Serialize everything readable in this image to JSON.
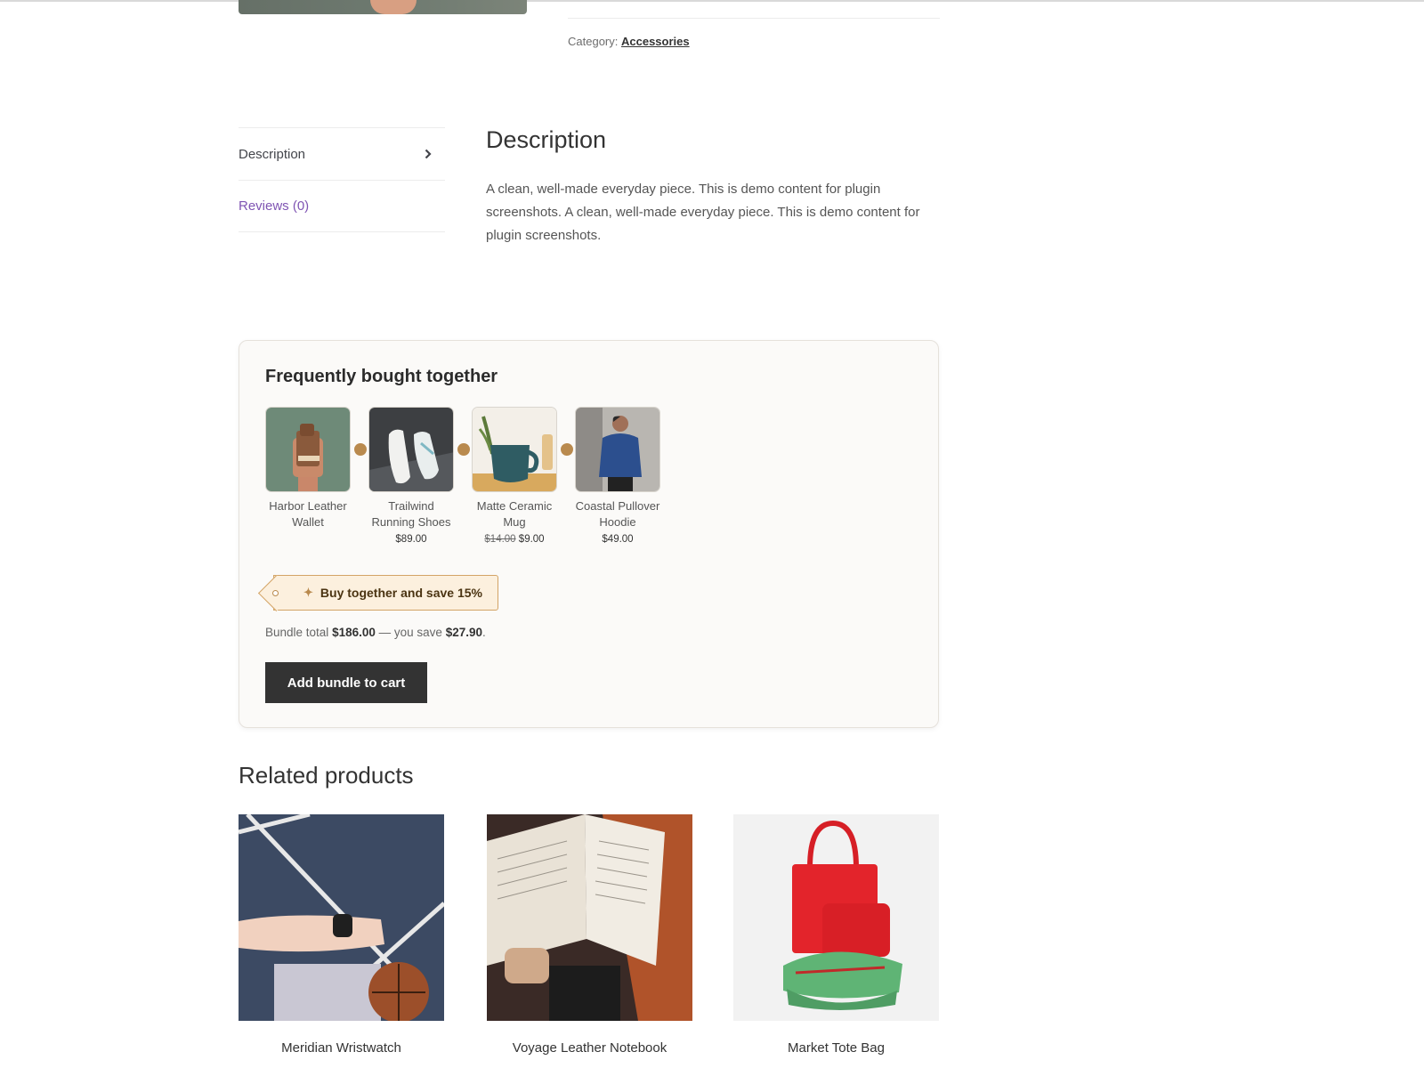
{
  "meta": {
    "category_label": "Category:",
    "category_link": "Accessories"
  },
  "tabs": [
    {
      "label": "Description",
      "active": true
    },
    {
      "label": "Reviews (0)",
      "active": false
    }
  ],
  "description": {
    "title": "Description",
    "text": "A clean, well-made everyday piece. This is demo content for plugin screenshots. A clean, well-made everyday piece. This is demo content for plugin screenshots."
  },
  "bundle": {
    "title": "Frequently bought together",
    "items": [
      {
        "name": "Harbor Leather Wallet",
        "price": "",
        "old_price": "",
        "image": "wallet-photo"
      },
      {
        "name": "Trailwind Running Shoes",
        "price": "$89.00",
        "old_price": "",
        "image": "shoes-photo"
      },
      {
        "name": "Matte Ceramic Mug",
        "price": "$9.00",
        "old_price": "$14.00",
        "image": "mug-photo"
      },
      {
        "name": "Coastal Pullover Hoodie",
        "price": "$49.00",
        "old_price": "",
        "image": "hoodie-photo"
      }
    ],
    "badge": "Buy together and save 15%",
    "total_prefix": "Bundle total",
    "total_value": "$186.00",
    "save_prefix": "— you save",
    "save_value": "$27.90",
    "save_suffix": ".",
    "button_label": "Add bundle to cart"
  },
  "related": {
    "title": "Related products",
    "items": [
      {
        "name": "Meridian Wristwatch",
        "image": "wristwatch-photo"
      },
      {
        "name": "Voyage Leather Notebook",
        "image": "notebook-photo"
      },
      {
        "name": "Market Tote Bag",
        "image": "tote-bag-photo"
      }
    ]
  },
  "colors": {
    "accent": "#b98a4e",
    "link_purple": "#7f54b3",
    "button_bg": "#333333",
    "badge_bg": "#fcf0de"
  }
}
